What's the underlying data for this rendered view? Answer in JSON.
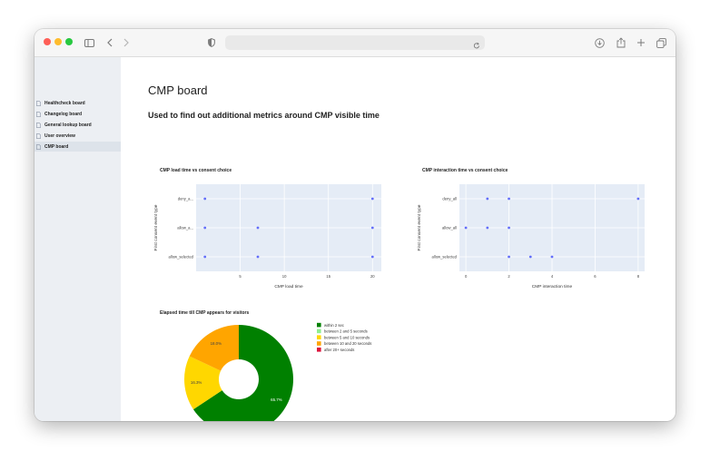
{
  "sidebar": {
    "items": [
      {
        "label": "Healthcheck board",
        "active": false
      },
      {
        "label": "Changelog board",
        "active": false
      },
      {
        "label": "General lookup board",
        "active": false
      },
      {
        "label": "User overview",
        "active": false
      },
      {
        "label": "CMP board",
        "active": true
      }
    ]
  },
  "main": {
    "title": "CMP board",
    "subtitle": "Used to find out additional metrics around CMP visible time"
  },
  "colors": {
    "plot_bg": "#e5ecf6",
    "marker": "#636efa",
    "green": "#008000",
    "light_green": "#90ee90",
    "gold": "#ffd700",
    "orange": "#ffa500",
    "red": "#dc143c"
  },
  "chart_data": [
    {
      "type": "scatter",
      "title": "CMP load time vs consent choice",
      "xlabel": "CMP load time",
      "ylabel": "First consent event type",
      "xlim": [
        0,
        21
      ],
      "x_ticks": [
        "5",
        "10",
        "15",
        "20"
      ],
      "categories": [
        "deny_a...",
        "allow_a...",
        "allow_selected"
      ],
      "points": [
        {
          "x": 1,
          "y": "deny_a..."
        },
        {
          "x": 20,
          "y": "deny_a..."
        },
        {
          "x": 1,
          "y": "allow_a..."
        },
        {
          "x": 7,
          "y": "allow_a..."
        },
        {
          "x": 20,
          "y": "allow_a..."
        },
        {
          "x": 1,
          "y": "allow_selected"
        },
        {
          "x": 7,
          "y": "allow_selected"
        },
        {
          "x": 20,
          "y": "allow_selected"
        }
      ]
    },
    {
      "type": "scatter",
      "title": "CMP interaction time vs consent choice",
      "xlabel": "CMP interaction time",
      "ylabel": "First consent event type",
      "xlim": [
        -0.3,
        8.3
      ],
      "x_ticks": [
        "0",
        "2",
        "4",
        "6",
        "8"
      ],
      "categories": [
        "deny_all",
        "allow_all",
        "allow_selected"
      ],
      "points": [
        {
          "x": 1,
          "y": "deny_all"
        },
        {
          "x": 2,
          "y": "deny_all"
        },
        {
          "x": 8,
          "y": "deny_all"
        },
        {
          "x": 0,
          "y": "allow_all"
        },
        {
          "x": 1,
          "y": "allow_all"
        },
        {
          "x": 2,
          "y": "allow_all"
        },
        {
          "x": 2,
          "y": "allow_selected"
        },
        {
          "x": 3,
          "y": "allow_selected"
        },
        {
          "x": 4,
          "y": "allow_selected"
        }
      ]
    },
    {
      "type": "pie",
      "title": "Elapsed time till CMP appears for visitors",
      "hole": true,
      "slices": [
        {
          "label": "within 2 sec",
          "value": 65.7,
          "text": "65.7%",
          "color": "#008000"
        },
        {
          "label": "between 2 and 5 seconds",
          "value": 0,
          "text": "",
          "color": "#90ee90"
        },
        {
          "label": "between 5 and 10 seconds",
          "value": 16.3,
          "text": "16.3%",
          "color": "#ffd700"
        },
        {
          "label": "between 10 and 20 seconds",
          "value": 18.0,
          "text": "18.0%",
          "color": "#ffa500"
        },
        {
          "label": "after 20+ seconds",
          "value": 0,
          "text": "",
          "color": "#dc143c"
        }
      ]
    }
  ]
}
